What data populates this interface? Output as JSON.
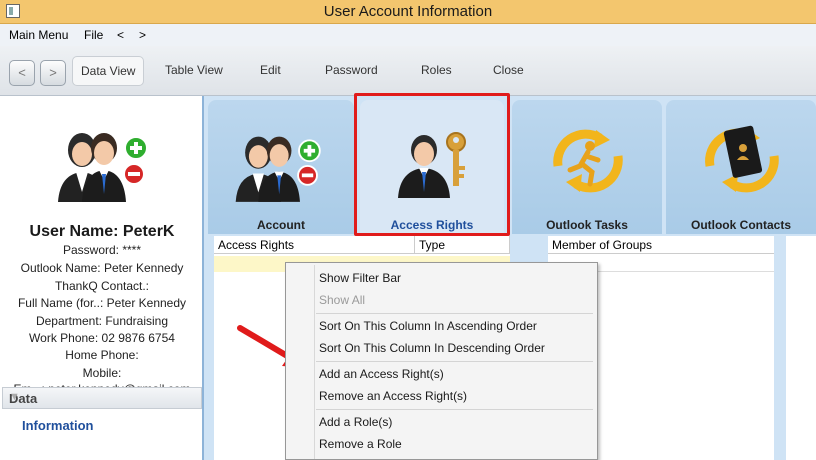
{
  "window": {
    "title": "User Account Information"
  },
  "menubar": {
    "items": [
      "Main Menu",
      "File",
      "<",
      ">"
    ]
  },
  "toolbar": {
    "back": "<",
    "forward": ">",
    "buttons": [
      "Data View",
      "Table View",
      "Edit",
      "Password",
      "Roles",
      "Close"
    ]
  },
  "user": {
    "username_line": "User Name: PeterK",
    "lines": [
      "Password: ****",
      "Outlook Name: Peter Kennedy",
      "ThankQ Contact.:",
      "Full Name (for..: Peter Kennedy",
      "Department: Fundraising",
      "Work Phone: 02 9876 6754",
      "Home Phone:",
      "Mobile:",
      "Em...: peter.kennedy@gmail.com"
    ]
  },
  "leftnav": {
    "section": "Data",
    "link": "Information"
  },
  "tabs": [
    {
      "label": "Account",
      "icon": "users-icon"
    },
    {
      "label": "Access Rights",
      "icon": "user-key-icon"
    },
    {
      "label": "Outlook Tasks",
      "icon": "tasks-runner-icon"
    },
    {
      "label": "Outlook Contacts",
      "icon": "contacts-book-icon"
    }
  ],
  "grid": {
    "columns": [
      "Access Rights",
      "Type"
    ]
  },
  "groups": {
    "column": "Member of Groups"
  },
  "context_menu": {
    "items": [
      "Show Filter Bar",
      "Show All",
      "Sort On This Column In Ascending Order",
      "Sort On This Column In Descending Order",
      "Add an Access Right(s)",
      "Remove an Access Right(s)",
      "Add a Role(s)",
      "Remove a Role"
    ]
  },
  "colors": {
    "highlight_box": "#e01b1b",
    "arrow": "#e01b1b",
    "link": "#1f4f9c"
  }
}
